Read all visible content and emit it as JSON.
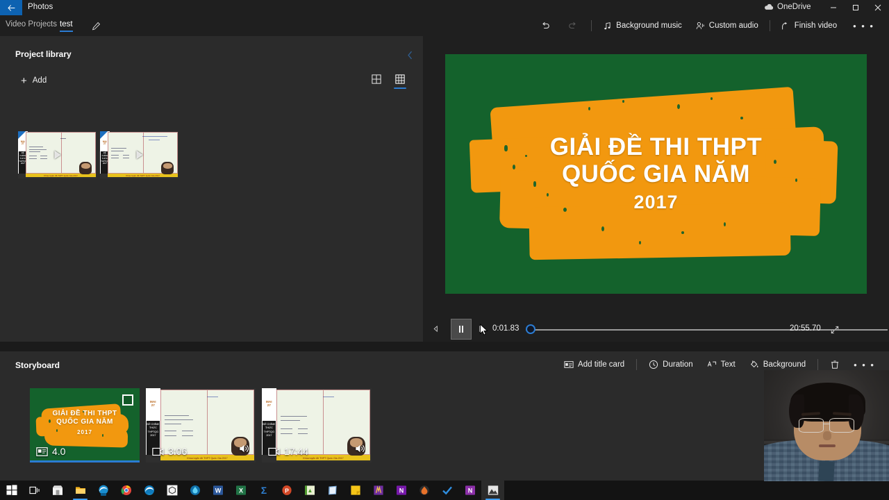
{
  "titlebar": {
    "back_icon": "back-arrow-icon",
    "app_title": "Photos",
    "onedrive_label": "OneDrive",
    "onedrive_icon": "cloud-icon",
    "minimize_icon": "minimize-icon",
    "maximize_icon": "maximize-icon",
    "close_icon": "close-icon"
  },
  "breadcrumb": {
    "root_label": "Video Projects",
    "separator": "›",
    "current_label": "test",
    "rename_icon": "pencil-icon"
  },
  "toolbar": {
    "undo_label": "Undo",
    "redo_label": "Redo",
    "background_music_label": "Background music",
    "custom_audio_label": "Custom audio",
    "finish_video_label": "Finish video",
    "more_label": "• • •"
  },
  "library": {
    "title": "Project library",
    "collapse_icon": "chevron-left-icon",
    "add_label": "Add",
    "view_large_icon": "grid-large-icon",
    "view_small_icon": "grid-small-icon",
    "selected_view": "grid-small-icon",
    "items": [
      {
        "date_line1": "MAI",
        "date_line2": "27",
        "banner": "ĐỀ CHÍNH THỨC THPTQG 2017",
        "caption": "Khóa luyện đề THPT Quốc Gia 2017"
      },
      {
        "date_line1": "MAI",
        "date_line2": "27",
        "banner": "ĐỀ CHÍNH THỨC THPTQG 2017",
        "caption": "Khóa luyện đề THPT Quốc Gia 2017"
      }
    ]
  },
  "preview": {
    "title_card": {
      "line1": "GIẢI ĐỀ THI THPT",
      "line2": "QUỐC GIA NĂM",
      "line3": "2017",
      "background_color": "#14622c",
      "brush_color": "#f2980f",
      "text_color": "#ffffff"
    },
    "transport": {
      "previous_frame_icon": "previous-frame-icon",
      "pause_icon": "pause-icon",
      "next_frame_icon": "next-frame-icon",
      "current_time": "0:01.83",
      "total_time": "20:55.70",
      "fullscreen_icon": "fullscreen-icon",
      "progress_percent": 0
    }
  },
  "storyboard": {
    "title": "Storyboard",
    "tools": {
      "add_title_card_label": "Add title card",
      "duration_label": "Duration",
      "text_label": "Text",
      "background_label": "Background",
      "delete_icon": "trash-icon",
      "more_label": "• • •"
    },
    "clips": [
      {
        "type": "title-card",
        "duration": "4.0",
        "selected": true,
        "checked": false,
        "line1": "GIẢI ĐỀ THI THPT",
        "line2": "QUỐC GIA NĂM",
        "line3": "2017",
        "badge_icon": "title-card-icon"
      },
      {
        "type": "video",
        "duration": "3:06",
        "selected": false,
        "badge_icon": "video-clip-icon",
        "audio_icon": "speaker-icon",
        "date_line1": "MAI",
        "date_line2": "27",
        "banner": "ĐỀ CHÍNH THỨC THPTQG 2017",
        "caption": "Khóa luyện đề THPT Quốc Gia 2017"
      },
      {
        "type": "video",
        "duration": "17:44",
        "selected": false,
        "badge_icon": "video-clip-icon",
        "audio_icon": "speaker-icon",
        "date_line1": "MAI",
        "date_line2": "27",
        "banner": "ĐỀ CHÍNH THỨC THPTQG 2017",
        "caption": "Khóa luyện đề THPT Quốc Gia 2017"
      }
    ]
  },
  "taskbar": {
    "items": [
      {
        "name": "start-button",
        "color": "#ffffff",
        "glyph": "⊞"
      },
      {
        "name": "task-view-button",
        "color": "#ffffff",
        "glyph": "⌸"
      },
      {
        "name": "microsoft-store",
        "color": "#f3f3f3",
        "glyph": ""
      },
      {
        "name": "file-explorer",
        "color": "#f0a500",
        "glyph": "",
        "running": true
      },
      {
        "name": "edge-beta",
        "color": "#1a8fd1",
        "glyph": ""
      },
      {
        "name": "google-chrome",
        "color": "#e8453c",
        "glyph": ""
      },
      {
        "name": "microsoft-edge",
        "color": "#0f7bbd",
        "glyph": ""
      },
      {
        "name": "unity-hub",
        "color": "#f2f2f2",
        "glyph": ""
      },
      {
        "name": "water-app",
        "color": "#2aa7df",
        "glyph": ""
      },
      {
        "name": "microsoft-word",
        "color": "#2b579a",
        "glyph": "W"
      },
      {
        "name": "microsoft-excel",
        "color": "#217346",
        "glyph": "X"
      },
      {
        "name": "mathtype",
        "color": "#1f6fb4",
        "glyph": "Σ"
      },
      {
        "name": "microsoft-powerpoint",
        "color": "#d24726",
        "glyph": "P"
      },
      {
        "name": "green-app",
        "color": "#57a639",
        "glyph": ""
      },
      {
        "name": "notes-app",
        "color": "#7faedd",
        "glyph": ""
      },
      {
        "name": "yellow-note-app",
        "color": "#f5c518",
        "glyph": ""
      },
      {
        "name": "purple-app",
        "color": "#7b3fa0",
        "glyph": ""
      },
      {
        "name": "onenote",
        "color": "#7719aa",
        "glyph": "N"
      },
      {
        "name": "orange-app",
        "color": "#e8722a",
        "glyph": ""
      },
      {
        "name": "todo-app",
        "color": "#2f8ee0",
        "glyph": "✔"
      },
      {
        "name": "onenote-2016",
        "color": "#8b2fa8",
        "glyph": "N"
      },
      {
        "name": "photos-app",
        "color": "#d7d7d7",
        "glyph": "",
        "active": true,
        "running": true
      }
    ]
  }
}
